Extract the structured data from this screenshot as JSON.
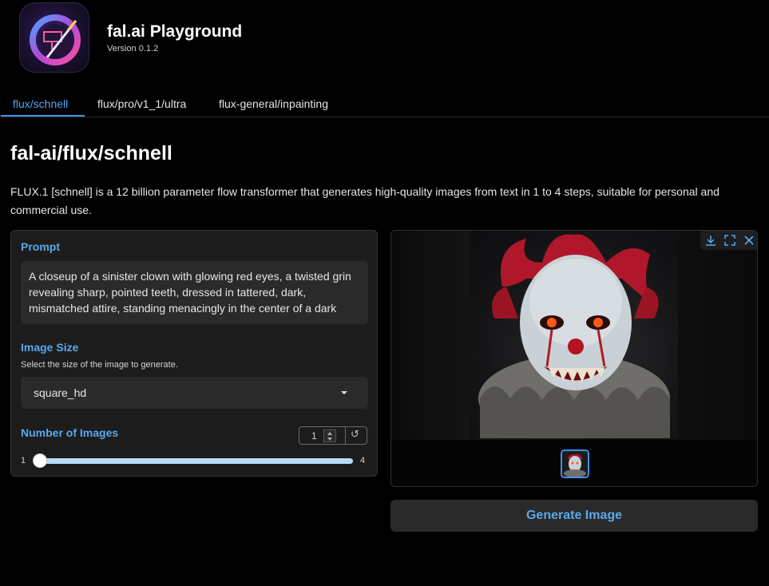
{
  "app": {
    "title": "fal.ai Playground",
    "version": "Version 0.1.2"
  },
  "tabs": [
    {
      "label": "flux/schnell",
      "active": true
    },
    {
      "label": "flux/pro/v1_1/ultra",
      "active": false
    },
    {
      "label": "flux-general/inpainting",
      "active": false
    }
  ],
  "page": {
    "title": "fal-ai/flux/schnell",
    "description": "FLUX.1 [schnell] is a 12 billion parameter flow transformer that generates high-quality images from text in 1 to 4 steps, suitable for personal and commercial use."
  },
  "form": {
    "prompt_label": "Prompt",
    "prompt_value": "A closeup of a sinister clown with glowing red eyes, a twisted grin revealing sharp, pointed teeth, dressed in tattered, dark, mismatched attire, standing menacingly in the center of a dark",
    "image_size_label": "Image Size",
    "image_size_description": "Select the size of the image to generate.",
    "image_size_value": "square_hd",
    "num_images_label": "Number of Images",
    "num_images_value": "1",
    "slider_min": "1",
    "slider_max": "4",
    "slider_fraction": 0
  },
  "output": {
    "generate_label": "Generate Image",
    "toolbar_icons": [
      "download-icon",
      "fullscreen-icon",
      "close-icon"
    ]
  },
  "colors": {
    "accent": "#5aa8ec",
    "tab_underline": "#3f93e6",
    "panel_bg": "#1c1c1c",
    "input_bg": "#2a2a2a"
  }
}
